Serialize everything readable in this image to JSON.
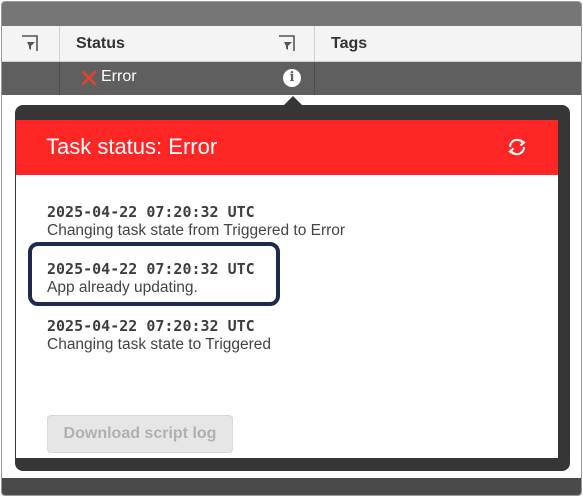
{
  "table": {
    "headers": {
      "status": "Status",
      "tags": "Tags"
    },
    "row": {
      "status_text": "Error"
    }
  },
  "popup": {
    "title": "Task status: Error",
    "entries": [
      {
        "timestamp": "2025-04-22 07:20:32 UTC",
        "message": "Changing task state from Triggered to Error"
      },
      {
        "timestamp": "2025-04-22 07:20:32 UTC",
        "message": "App already updating."
      },
      {
        "timestamp": "2025-04-22 07:20:32 UTC",
        "message": "Changing task state to Triggered"
      }
    ],
    "download_button": "Download script log"
  },
  "colors": {
    "header_red": "#ff2626",
    "highlight_border": "#1d2a4e",
    "error_icon": "#e8412b"
  },
  "icons": [
    "filter-icon",
    "error-x-icon",
    "info-icon",
    "refresh-icon"
  ]
}
